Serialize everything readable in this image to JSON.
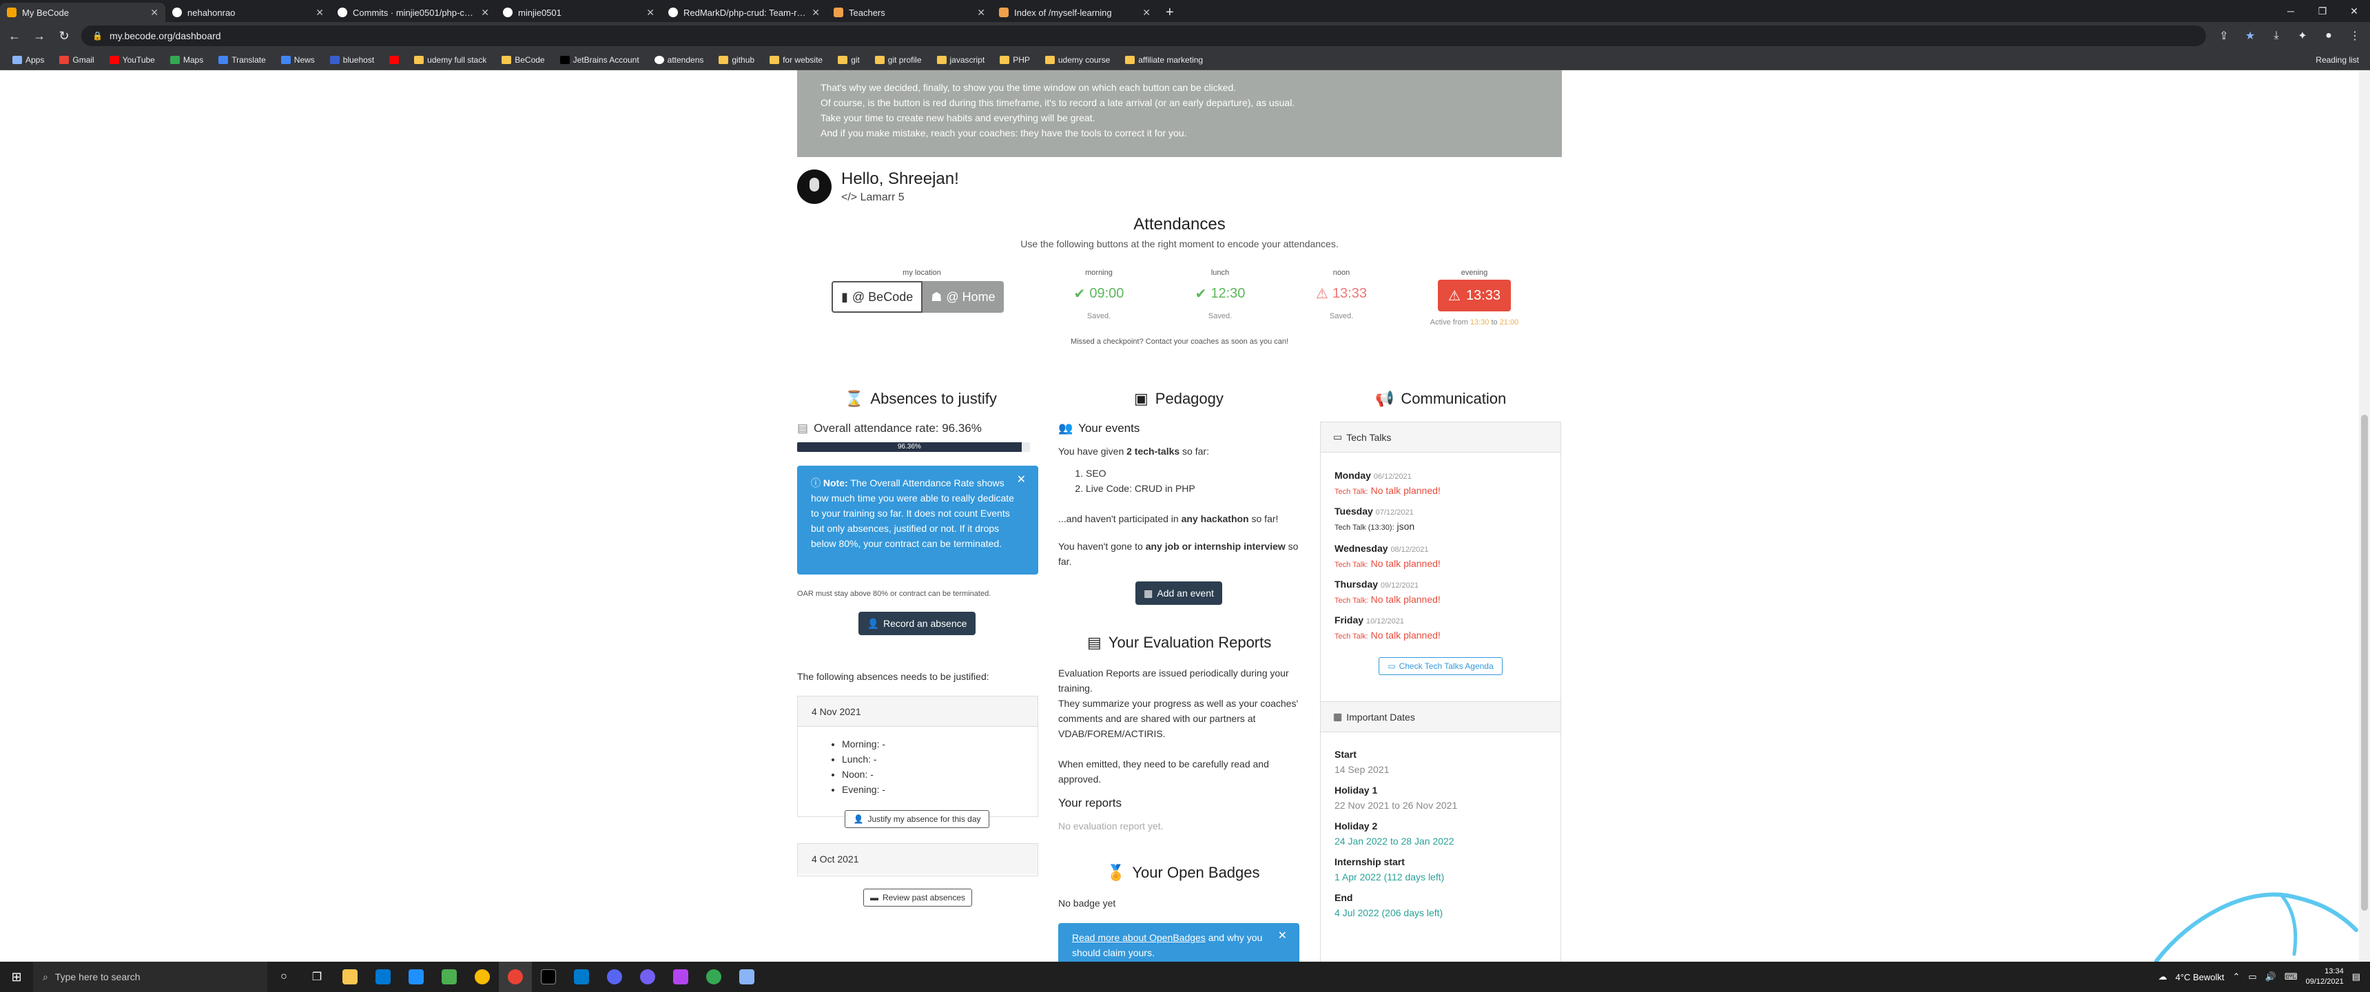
{
  "browser": {
    "tabs": [
      {
        "title": "My BeCode",
        "active": true,
        "color": "#e8eaed"
      },
      {
        "title": "nehahonrao",
        "active": false,
        "color": "#e8eaed"
      },
      {
        "title": "Commits · minjie0501/php-crud",
        "active": false,
        "color": "#e8eaed"
      },
      {
        "title": "minjie0501",
        "active": false,
        "color": "#e8eaed"
      },
      {
        "title": "RedMarkD/php-crud: Team-rep...",
        "active": false,
        "color": "#e8eaed"
      },
      {
        "title": "Teachers",
        "active": false,
        "color": "#f0a04b"
      },
      {
        "title": "Index of /myself-learning",
        "active": false,
        "color": "#f0a04b"
      }
    ],
    "new_tab": "+",
    "url": "my.becode.org/dashboard",
    "bookmarks": [
      "Apps",
      "Gmail",
      "YouTube",
      "Maps",
      "Translate",
      "News",
      "bluehost",
      "",
      "udemy full stack",
      "BeCode",
      "JetBrains Account",
      "attendens",
      "github",
      "for website",
      "git",
      "git profile",
      "javascript",
      "PHP",
      "udemy course",
      "affiliate marketing"
    ],
    "reading_list": "Reading list"
  },
  "info_lines": [
    "That's why we decided, finally, to show you the time window on which each button can be clicked.",
    "Of course, is the button is red during this timeframe, it's to record a late arrival (or an early departure), as usual.",
    "Take your time to create new habits and everything will be great.",
    "And if you make mistake, reach your coaches: they have the tools to correct it for you."
  ],
  "user": {
    "greeting": "Hello, Shreejan!",
    "promo": "Lamarr 5"
  },
  "attendances": {
    "title": "Attendances",
    "desc": "Use the following buttons at the right moment to encode your attendances.",
    "location_label": "my location",
    "loc_becode": "@ BeCode",
    "loc_home": "@ Home",
    "morning": {
      "label": "morning",
      "time": "09:00",
      "status": "Saved."
    },
    "lunch": {
      "label": "lunch",
      "time": "12:30",
      "status": "Saved."
    },
    "noon": {
      "label": "noon",
      "time": "13:33",
      "status": "Saved."
    },
    "evening": {
      "label": "evening",
      "time": "13:33",
      "active_prefix": "Active from ",
      "active_start": "13:30",
      "active_mid": " to ",
      "active_end": "21:00"
    },
    "missed": "Missed a checkpoint? Contact your coaches as soon as you can!"
  },
  "absences": {
    "title": "Absences to justify",
    "oar_label": "Overall attendance rate: 96.36%",
    "oar_value": 96.36,
    "oar_bar_text": "96.36%",
    "note_bold": "Note:",
    "note_text": " The Overall Attendance Rate shows how much time you were able to really dedicate to your training so far. It does not count Events but only absences, justified or not. If it drops below 80%, your contract can be terminated.",
    "oar_warning": "OAR must stay above 80% or contract can be terminated.",
    "record_btn": "Record an absence",
    "needs_justify": "The following absences needs to be justified:",
    "cards": [
      {
        "date": "4 Nov 2021",
        "items": [
          "Morning: -",
          "Lunch: -",
          "Noon: -",
          "Evening: -"
        ],
        "justify_btn": "Justify my absence for this day"
      },
      {
        "date": "4 Oct 2021"
      }
    ],
    "review_btn": "Review past absences"
  },
  "pedagogy": {
    "title": "Pedagogy",
    "events_title": "Your events",
    "given_pre": "You have given ",
    "given_bold": "2 tech-talks",
    "given_post": " so far:",
    "talks": [
      "SEO",
      "Live Code: CRUD in PHP"
    ],
    "hack_pre": "...and haven't participated in ",
    "hack_bold": "any hackathon",
    "hack_post": " so far!",
    "job_pre": "You haven't gone to ",
    "job_bold": "any job or internship interview",
    "job_post": " so far.",
    "add_event_btn": "Add an event",
    "eval_title": "Your Evaluation Reports",
    "eval_p1": "Evaluation Reports are issued periodically during your training.",
    "eval_p2": "They summarize your progress as well as your coaches' comments and are shared with our partners at VDAB/FOREM/ACTIRIS.",
    "eval_p3": "When emitted, they need to be carefully read and approved.",
    "reports_title": "Your reports",
    "no_reports": "No evaluation report yet.",
    "badges_title": "Your Open Badges",
    "no_badge": "No badge yet",
    "badge_link": "Read more about OpenBadges",
    "badge_text": " and why you should claim yours."
  },
  "communication": {
    "title": "Communication",
    "tech_talks_title": "Tech Talks",
    "days": [
      {
        "day": "Monday",
        "date": "06/12/2021",
        "tt": "Tech Talk:",
        "value": "No talk planned!"
      },
      {
        "day": "Tuesday",
        "date": "07/12/2021",
        "tt": "Tech Talk (13:30):",
        "value": "json"
      },
      {
        "day": "Wednesday",
        "date": "08/12/2021",
        "tt": "Tech Talk:",
        "value": "No talk planned!"
      },
      {
        "day": "Thursday",
        "date": "09/12/2021",
        "tt": "Tech Talk:",
        "value": "No talk planned!"
      },
      {
        "day": "Friday",
        "date": "10/12/2021",
        "tt": "Tech Talk:",
        "value": "No talk planned!"
      }
    ],
    "agenda_btn": "Check Tech Talks Agenda",
    "dates_title": "Important Dates",
    "dates": [
      {
        "label": "Start",
        "value": "14 Sep 2021"
      },
      {
        "label": "Holiday 1",
        "value": "22 Nov 2021 to 26 Nov 2021"
      },
      {
        "label": "Holiday 2",
        "value": "24 Jan 2022 to 28 Jan 2022"
      },
      {
        "label": "Internship start",
        "value": "1 Apr 2022 (112 days left)"
      },
      {
        "label": "End",
        "value": "4 Jul 2022 (206 days left)"
      }
    ]
  },
  "taskbar": {
    "search_placeholder": "Type here to search",
    "weather": "4°C  Bewolkt",
    "time": "13:34",
    "date": "09/12/2021"
  }
}
